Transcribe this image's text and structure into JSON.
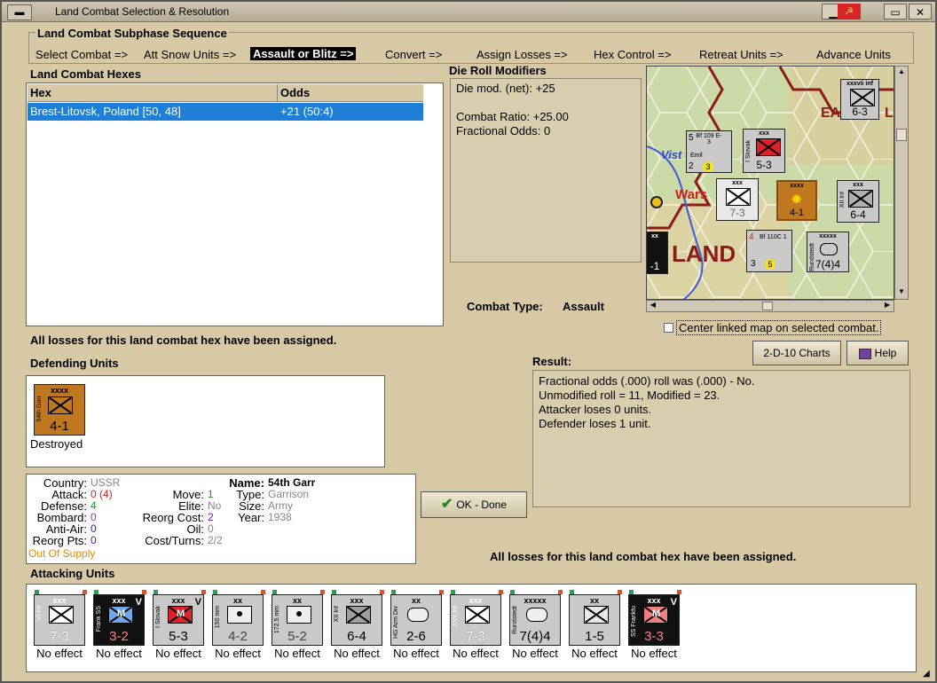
{
  "window": {
    "title": "Land Combat Selection & Resolution"
  },
  "subphase": {
    "heading": "Land Combat Subphase Sequence",
    "steps": [
      "Select Combat =>",
      "Att Snow Units =>",
      "Assault or Blitz =>",
      "Convert =>",
      "Assign Losses =>",
      "Hex Control =>",
      "Retreat Units =>",
      "Advance Units"
    ],
    "active_index": 2
  },
  "hexes": {
    "heading": "Land Combat Hexes",
    "columns": [
      "Hex",
      "Odds"
    ],
    "rows": [
      {
        "hex": "Brest-Litovsk, Poland [50, 48]",
        "odds": "+21 (50:4)"
      }
    ]
  },
  "drm": {
    "heading": "Die Roll Modifiers",
    "lines": [
      "Die mod. (net): +25",
      "",
      "Combat Ratio: +25.00",
      "Fractional Odds: 0"
    ]
  },
  "combat_type": {
    "label": "Combat Type:",
    "value": "Assault"
  },
  "map": {
    "labels": {
      "east": "EA",
      "east2": "L",
      "vistula": "Vist",
      "warsaw": "Wars",
      "land": "LAND",
      "land_prefix": "L"
    },
    "units": [
      {
        "top": "xxxvii inf",
        "value": "6-3"
      },
      {
        "top": "Bf 109 E-3",
        "value": "2",
        "extra": "5",
        "sub": "Emil",
        "circle": "3"
      },
      {
        "top": "xxx",
        "value": "5-3",
        "side": "I Slovak"
      },
      {
        "top": "xxx",
        "value": "7-3"
      },
      {
        "top": "xxxx",
        "value": "4-1",
        "side": "54th Garr"
      },
      {
        "top": "xxx",
        "value": "6-4",
        "side": "XII Inf"
      },
      {
        "top": "Bf 110C 1",
        "value": "3",
        "extra": "4",
        "circle": "5"
      },
      {
        "top": "xxxxx",
        "value": "7(4)4",
        "side": "Rundstedt"
      },
      {
        "top": "xx",
        "value": "-1"
      }
    ],
    "checkbox_label": "Center linked map on selected combat."
  },
  "buttons": {
    "charts": "2-D-10 Charts",
    "help": "Help",
    "ok": "OK - Done"
  },
  "loss_message_top": "All losses for this land combat hex have been assigned.",
  "loss_message_bottom": "All losses for this land combat hex have been assigned.",
  "result": {
    "heading": "Result:",
    "lines": [
      "Fractional odds (.000) roll was (.000)  - No.",
      "Unmodified roll = 11, Modified = 23.",
      "Attacker loses 0 units.",
      "Defender loses 1 unit."
    ]
  },
  "defending": {
    "heading": "Defending Units",
    "units": [
      {
        "top": "xxxx",
        "side": "54th Garr",
        "value": "4-1",
        "status": "Destroyed"
      }
    ]
  },
  "unit_info": {
    "country_label": "Country:",
    "country": "USSR",
    "attack_label": "Attack:",
    "attack": "0",
    "attack_mod": "(4)",
    "defense_label": "Defense:",
    "defense": "4",
    "bombard_label": "Bombard:",
    "bombard": "0",
    "antiair_label": "Anti-Air:",
    "antiair": "0",
    "reorg_label": "Reorg Pts:",
    "reorg": "0",
    "supply": "Out Of Supply",
    "move_label": "Move:",
    "move": "1",
    "elite_label": "Elite:",
    "elite": "No",
    "reorgcost_label": "Reorg Cost:",
    "reorgcost": "2",
    "oil_label": "Oil:",
    "oil": "0",
    "costturns_label": "Cost/Turns:",
    "costturns": "2/2",
    "name_label": "Name:",
    "name": "54th Garr",
    "type_label": "Type:",
    "type": "Garrison",
    "size_label": "Size:",
    "size": "Army",
    "year_label": "Year:",
    "year": "1938"
  },
  "attacking": {
    "heading": "Attacking Units",
    "units": [
      {
        "top": "xxx",
        "side": "VI Inf",
        "value": "7-3",
        "status": "No effect",
        "style": "grey",
        "v": ""
      },
      {
        "top": "xxx",
        "side": "Frank SS",
        "value": "3-2",
        "status": "No effect",
        "style": "black-blue",
        "v": "V"
      },
      {
        "top": "xxx",
        "side": "I Slovak",
        "value": "5-3",
        "status": "No effect",
        "style": "grey-red",
        "v": "V"
      },
      {
        "top": "xx",
        "side": "150 mm",
        "value": "4-2",
        "status": "No effect",
        "style": "grey-art",
        "v": ""
      },
      {
        "top": "xx",
        "side": "172.5 mm",
        "value": "5-2",
        "status": "No effect",
        "style": "grey-art",
        "v": ""
      },
      {
        "top": "xxx",
        "side": "XII Inf",
        "value": "6-4",
        "status": "No effect",
        "style": "darkgrey",
        "v": ""
      },
      {
        "top": "xx",
        "side": "HG Arm Div",
        "value": "2-6",
        "status": "No effect",
        "style": "grey-arm",
        "v": ""
      },
      {
        "top": "xxx",
        "side": "XVII Inf",
        "value": "7-3",
        "status": "No effect",
        "style": "grey",
        "v": ""
      },
      {
        "top": "xxxxx",
        "side": "Rundstedt",
        "value": "7(4)4",
        "status": "No effect",
        "style": "grey-arm",
        "v": ""
      },
      {
        "top": "xx",
        "side": "",
        "value": "1-5",
        "status": "No effect",
        "style": "grey-para",
        "v": ""
      },
      {
        "top": "xxx",
        "side": "SS Frankfu",
        "value": "3-3",
        "status": "No effect",
        "style": "black-pink",
        "v": "V"
      }
    ]
  },
  "colors": {
    "panel": "#d7c9a6",
    "selection": "#1e7fd8",
    "active_step_bg": "#000000",
    "supply_warning": "#e08a00"
  }
}
